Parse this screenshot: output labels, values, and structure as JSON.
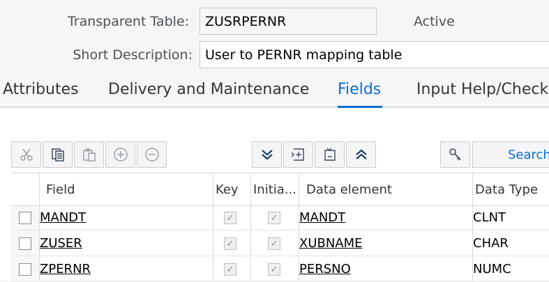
{
  "header": {
    "table_label": "Transparent Table:",
    "table_value": "ZUSRPERNR",
    "status": "Active",
    "desc_label": "Short Description:",
    "desc_value": "User to PERNR mapping table"
  },
  "tabs": [
    {
      "label": "Attributes",
      "active": false
    },
    {
      "label": "Delivery and Maintenance",
      "active": false
    },
    {
      "label": "Fields",
      "active": true
    },
    {
      "label": "Input Help/Check",
      "active": false
    }
  ],
  "toolbar": {
    "buttons": [
      "cut-icon",
      "copy-icon",
      "paste-icon",
      "insert-row-icon",
      "delete-row-icon",
      "expand-all-icon",
      "insert-field-icon",
      "delete-field-icon",
      "collapse-all-icon",
      "key-icon"
    ],
    "search_label": "Search"
  },
  "table": {
    "columns": [
      "Field",
      "Key",
      "Initia...",
      "Data element",
      "Data Type"
    ],
    "rows": [
      {
        "field": "MANDT",
        "key": true,
        "initial": true,
        "data_element": "MANDT",
        "data_type": "CLNT"
      },
      {
        "field": "ZUSER",
        "key": true,
        "initial": true,
        "data_element": "XUBNAME",
        "data_type": "CHAR"
      },
      {
        "field": "ZPERNR",
        "key": true,
        "initial": true,
        "data_element": "PERSNO",
        "data_type": "NUMC"
      }
    ]
  },
  "colors": {
    "accent": "#0a6ed1",
    "text": "#32363a"
  }
}
